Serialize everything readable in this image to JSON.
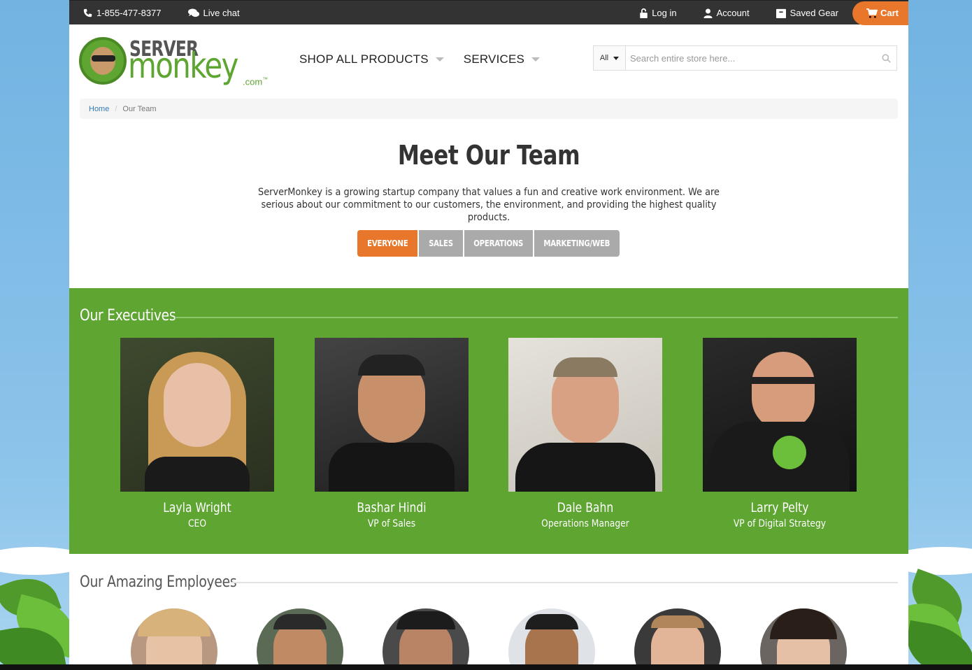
{
  "topbar": {
    "phone": "1-855-477-8377",
    "live_chat": "Live chat",
    "login": "Log in",
    "account": "Account",
    "saved_gear": "Saved Gear",
    "cart": "Cart"
  },
  "brand": {
    "server": "SERVER",
    "monkey": "monkey",
    "com": ".com",
    "tm": "™"
  },
  "nav": {
    "shop_all": "SHOP ALL PRODUCTS",
    "services": "SERVICES"
  },
  "search": {
    "category": "All",
    "placeholder": "Search entire store here..."
  },
  "breadcrumb": {
    "home": "Home",
    "separator": "/",
    "current": "Our Team"
  },
  "hero": {
    "title": "Meet Our Team",
    "description": "ServerMonkey is a growing startup company that values a fun and creative work environment. We are serious about our commitment to our customers, the environment, and providing the highest quality products."
  },
  "filters": [
    "EVERYONE",
    "SALES",
    "OPERATIONS",
    "MARKETING/WEB"
  ],
  "active_filter": "EVERYONE",
  "executives": {
    "title": "Our Executives",
    "members": [
      {
        "name": "Layla Wright",
        "role": "CEO"
      },
      {
        "name": "Bashar Hindi",
        "role": "VP of Sales"
      },
      {
        "name": "Dale Bahn",
        "role": "Operations Manager"
      },
      {
        "name": "Larry Pelty",
        "role": "VP of Digital Strategy"
      }
    ]
  },
  "employees": {
    "title": "Our Amazing Employees"
  },
  "colors": {
    "brand_green": "#5ea532",
    "accent_orange": "#e8762b",
    "filter_gray": "#aaaaaa",
    "topbar_dark": "#333333"
  }
}
